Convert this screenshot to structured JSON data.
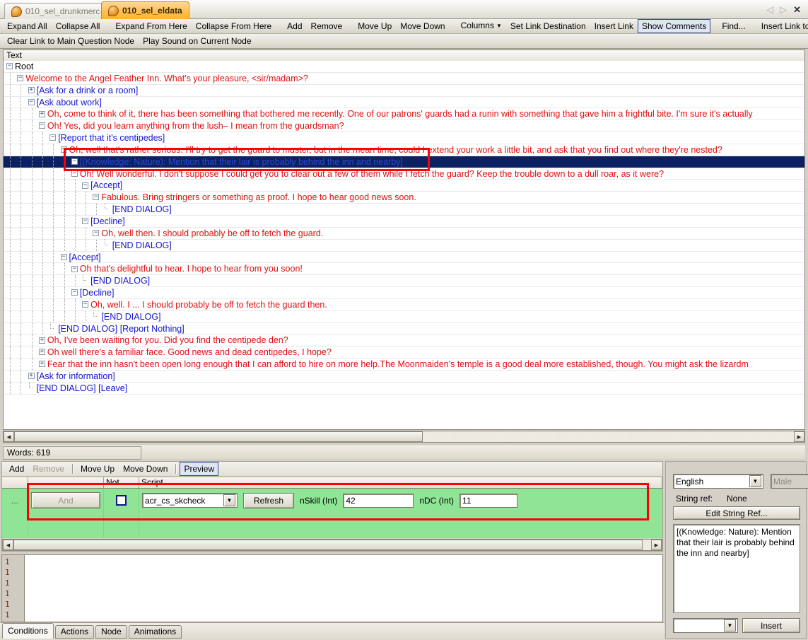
{
  "window": {
    "tabs": [
      {
        "label": "010_sel_drunkmerc",
        "active": false,
        "icon": "dialog-bubble-icon"
      },
      {
        "label": "010_sel_eldata",
        "active": true,
        "icon": "dialog-bubble-icon"
      }
    ],
    "controls": {
      "prev": "◁",
      "next": "▷",
      "close": "✕"
    }
  },
  "toolbar": {
    "row1": [
      {
        "label": "Expand All",
        "type": "cmd"
      },
      {
        "label": "Collapse All",
        "type": "cmd"
      },
      {
        "type": "sep"
      },
      {
        "label": "Expand From Here",
        "type": "cmd"
      },
      {
        "label": "Collapse From Here",
        "type": "cmd"
      },
      {
        "type": "sep"
      },
      {
        "label": "Add",
        "type": "cmd"
      },
      {
        "label": "Remove",
        "type": "cmd"
      },
      {
        "type": "sep"
      },
      {
        "label": "Move Up",
        "type": "cmd"
      },
      {
        "label": "Move Down",
        "type": "cmd"
      },
      {
        "type": "sep"
      },
      {
        "label": "Columns",
        "type": "cmd",
        "caret": true
      },
      {
        "label": "Set Link Destination",
        "type": "cmd"
      },
      {
        "label": "Insert Link",
        "type": "cmd"
      },
      {
        "label": "Show Comments",
        "type": "cmd",
        "selected": true
      },
      {
        "type": "sep"
      },
      {
        "label": "Find...",
        "type": "cmd"
      },
      {
        "type": "sep"
      },
      {
        "label": "Insert Link to Main Question Node",
        "type": "cmd"
      }
    ],
    "row2": [
      {
        "label": "Clear Link to Main Question Node",
        "type": "cmd"
      },
      {
        "label": "Play Sound on Current Node",
        "type": "cmd"
      }
    ]
  },
  "tree": {
    "header": "Text",
    "rows": [
      {
        "indent": 0,
        "marker": "minus",
        "text": "Root",
        "color": "black"
      },
      {
        "indent": 1,
        "marker": "minus",
        "text": "Welcome to the Angel Feather Inn. What's your pleasure, <sir/madam>?",
        "color": "red"
      },
      {
        "indent": 2,
        "marker": "plus",
        "text": "[Ask for a drink or a room]",
        "color": "blue"
      },
      {
        "indent": 2,
        "marker": "minus",
        "text": "[Ask about work]",
        "color": "blue"
      },
      {
        "indent": 3,
        "marker": "plus",
        "text": "Oh, come to think of it, there has been something that bothered me recently. One of our patrons' guards had a runin with something that gave him a frightful bite. I'm sure it's actually",
        "color": "red"
      },
      {
        "indent": 3,
        "marker": "minus",
        "text": "Oh! Yes, did you learn anything from the lush– I mean from the guardsman?",
        "color": "red"
      },
      {
        "indent": 4,
        "marker": "minus",
        "text": "[Report that it's centipedes]",
        "color": "blue"
      },
      {
        "indent": 5,
        "marker": "minus",
        "text": "Oh, well that's rather serious. I'll try to get the guard to muster, but in the mean time, could I extend your work a little bit, and ask that you find out where they're nested?",
        "color": "red"
      },
      {
        "indent": 6,
        "marker": "minus",
        "text": "[(Knowledge: Nature): Mention that their lair is probably behind the inn and nearby]",
        "color": "blue",
        "selected": true
      },
      {
        "indent": 6,
        "marker": "minus",
        "text": "Oh! Well wonderful. I don't suppose I could get you to clear out a few of them while I fetch the guard? Keep the trouble down to a dull roar, as it were?",
        "color": "red"
      },
      {
        "indent": 7,
        "marker": "minus",
        "text": "[Accept]",
        "color": "blue"
      },
      {
        "indent": 8,
        "marker": "minus",
        "text": "Fabulous. Bring stringers or something as proof. I hope to hear good news soon.",
        "color": "red"
      },
      {
        "indent": 9,
        "marker": "leaf",
        "text": "[END DIALOG]",
        "color": "blue"
      },
      {
        "indent": 7,
        "marker": "minus",
        "text": "[Decline]",
        "color": "blue"
      },
      {
        "indent": 8,
        "marker": "minus",
        "text": "Oh, well then. I should probably be off to fetch the guard.",
        "color": "red"
      },
      {
        "indent": 9,
        "marker": "leaf",
        "text": "[END DIALOG]",
        "color": "blue"
      },
      {
        "indent": 5,
        "marker": "minus",
        "text": "[Accept]",
        "color": "blue"
      },
      {
        "indent": 6,
        "marker": "minus",
        "text": "Oh that's delightful to hear. I hope to hear from you soon!",
        "color": "red"
      },
      {
        "indent": 7,
        "marker": "leaf",
        "text": "[END DIALOG]",
        "color": "blue"
      },
      {
        "indent": 6,
        "marker": "minus",
        "text": "[Decline]",
        "color": "blue"
      },
      {
        "indent": 7,
        "marker": "minus",
        "text": "Oh, well. I ... I should probably be off to fetch the guard then.",
        "color": "red"
      },
      {
        "indent": 8,
        "marker": "leaf",
        "text": "[END DIALOG]",
        "color": "blue"
      },
      {
        "indent": 4,
        "marker": "leaf",
        "text": "[END DIALOG] [Report Nothing]",
        "color": "blue"
      },
      {
        "indent": 3,
        "marker": "plus",
        "text": "Oh, I've been waiting for you. Did you find the centipede den?",
        "color": "red"
      },
      {
        "indent": 3,
        "marker": "plus",
        "text": "Oh well there's a familiar face. Good news and dead centipedes, I hope?",
        "color": "red"
      },
      {
        "indent": 3,
        "marker": "plus",
        "text": "Fear that the inn hasn't been open long enough that I can afford to hire on more help.The Moonmaiden's temple is a good deal more established, though. You might ask the lizardm",
        "color": "red"
      },
      {
        "indent": 2,
        "marker": "plus",
        "text": "[Ask for information]",
        "color": "blue"
      },
      {
        "indent": 2,
        "marker": "leaf",
        "text": "[END DIALOG] [Leave]",
        "color": "blue"
      }
    ]
  },
  "status": {
    "words_label": "Words: 619"
  },
  "conditions": {
    "toolbar": [
      {
        "label": "Add",
        "disabled": false
      },
      {
        "label": "Remove",
        "disabled": true
      },
      {
        "type": "sep"
      },
      {
        "label": "Move Up",
        "disabled": false
      },
      {
        "label": "Move Down",
        "disabled": false
      },
      {
        "type": "sep"
      },
      {
        "label": "Preview",
        "selected": true
      }
    ],
    "columns": [
      "",
      "",
      "Not",
      "Script"
    ],
    "row": {
      "dots": "...",
      "and_label": "And",
      "not_checked": false,
      "script_value": "acr_cs_skcheck",
      "refresh_label": "Refresh",
      "params": [
        {
          "label": "nSkill (Int)",
          "value": "42"
        },
        {
          "label": "nDC (Int)",
          "value": "11"
        }
      ]
    }
  },
  "script_editor": {
    "line_numbers": [
      "1",
      "1",
      "1",
      "1",
      "1",
      "1"
    ],
    "content": ""
  },
  "bottom_tabs": [
    {
      "label": "Conditions",
      "active": true
    },
    {
      "label": "Actions",
      "active": false
    },
    {
      "label": "Node",
      "active": false
    },
    {
      "label": "Animations",
      "active": false
    }
  ],
  "right_panel": {
    "language": "English",
    "gender": "Male",
    "string_ref_label": "String ref:",
    "string_ref_value": "None",
    "edit_string_ref_label": "Edit String Ref...",
    "text_value": "[(Knowledge: Nature): Mention that their lair is probably behind the inn and nearby]",
    "token_combo_value": "",
    "insert_label": "Insert"
  },
  "colors": {
    "selection_bg": "#0b2161",
    "selection_text": "#2d4ad8",
    "npc_text": "#e10f0f",
    "pc_text": "#1414d2",
    "annotation": "#ff0000",
    "grid_row": "#8fe495",
    "active_tab": "#ffbe4d"
  }
}
